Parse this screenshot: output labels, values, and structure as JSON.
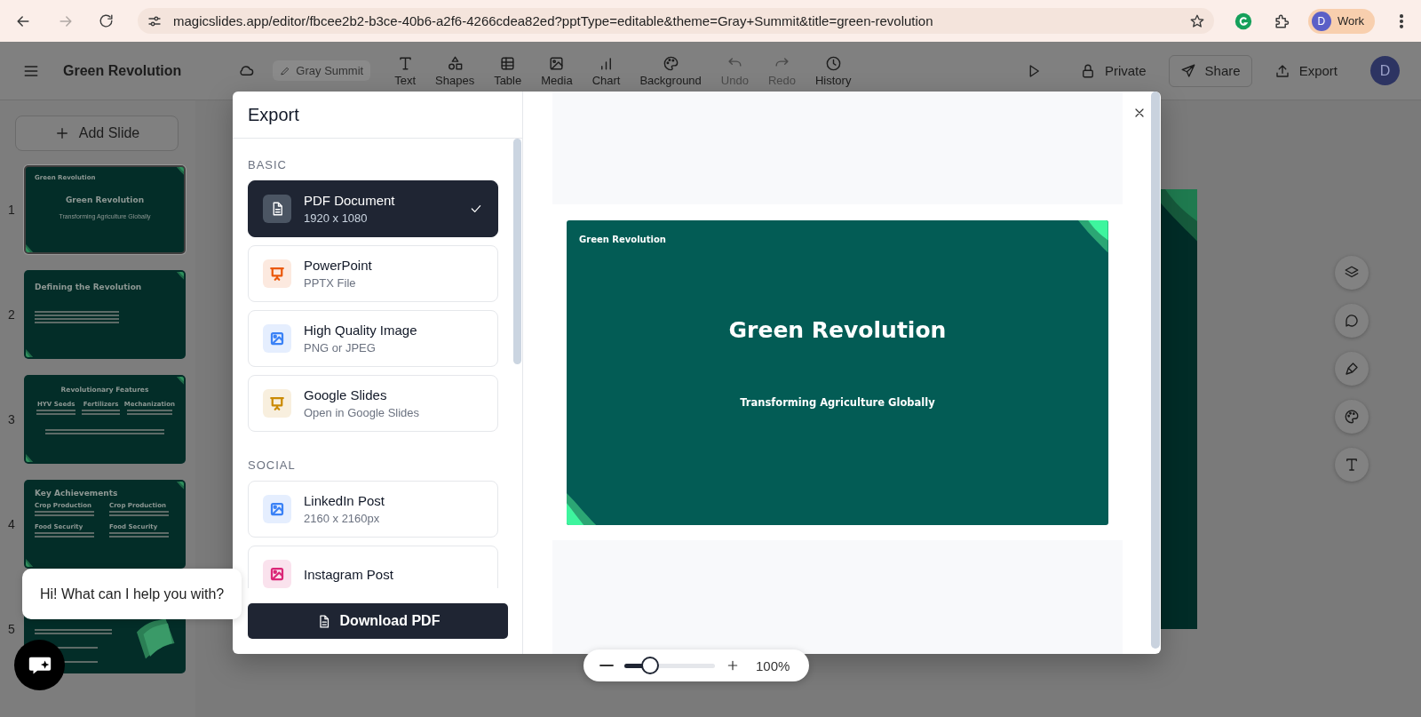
{
  "browser": {
    "url": "magicslides.app/editor/fbcee2b2-b3ce-40b6-a2f6-4266cdea82ed?pptType=editable&theme=Gray+Summit&title=green-revolution",
    "profile": {
      "initial": "D",
      "label": "Work"
    }
  },
  "toolbar": {
    "title": "Green Revolution",
    "theme": "Gray Summit",
    "tools": [
      {
        "label": "Text",
        "disabled": false
      },
      {
        "label": "Shapes",
        "disabled": false
      },
      {
        "label": "Table",
        "disabled": false
      },
      {
        "label": "Media",
        "disabled": false
      },
      {
        "label": "Chart",
        "disabled": false
      },
      {
        "label": "Background",
        "disabled": false
      },
      {
        "label": "Undo",
        "disabled": true
      },
      {
        "label": "Redo",
        "disabled": true
      },
      {
        "label": "History",
        "disabled": false
      }
    ],
    "actions": [
      {
        "label": "Private",
        "kind": "plain"
      },
      {
        "label": "Share",
        "kind": "outlined"
      },
      {
        "label": "Export",
        "kind": "plain"
      }
    ],
    "avatar": "D"
  },
  "sidebar": {
    "add_button": "Add Slide",
    "slides": [
      {
        "number": "1",
        "kind": "title",
        "selected": true,
        "header": "Green Revolution",
        "title": "Green Revolution",
        "subtitle": "Transforming Agriculture Globally"
      },
      {
        "number": "2",
        "kind": "text",
        "selected": false,
        "title": "Defining the Revolution"
      },
      {
        "number": "3",
        "kind": "columns",
        "selected": false,
        "title": "Revolutionary Features",
        "columns": [
          "HYV Seeds",
          "Fertilizers",
          "Mechanization"
        ]
      },
      {
        "number": "4",
        "kind": "grid",
        "selected": false,
        "title": "Key Achievements",
        "items": [
          "Crop Production",
          "Crop Production",
          "Food Security",
          "Food Security"
        ]
      },
      {
        "number": "5",
        "kind": "list",
        "selected": false
      }
    ]
  },
  "modal": {
    "title": "Export",
    "sections": [
      {
        "heading": "BASIC",
        "options": [
          {
            "title": "PDF Document",
            "subtitle": "1920 x 1080",
            "kind": "document",
            "color": "#4b5563",
            "selected": true
          },
          {
            "title": "PowerPoint",
            "subtitle": "PPTX File",
            "kind": "presentation",
            "color": "#ea580c",
            "selected": false
          },
          {
            "title": "High Quality Image",
            "subtitle": "PNG or JPEG",
            "kind": "image",
            "color": "#3b82f6",
            "selected": false
          },
          {
            "title": "Google Slides",
            "subtitle": "Open in Google Slides",
            "kind": "presentation",
            "color": "#ca8a04",
            "selected": false
          }
        ]
      },
      {
        "heading": "SOCIAL",
        "options": [
          {
            "title": "LinkedIn Post",
            "subtitle": "2160 x 2160px",
            "kind": "image",
            "color": "#3b82f6",
            "selected": false
          },
          {
            "title": "Instagram Post",
            "kind": "image",
            "color": "#db2777",
            "selected": false
          }
        ]
      }
    ],
    "download_button": "Download PDF",
    "preview": {
      "header": "Green Revolution",
      "title": "Green Revolution",
      "subtitle": "Transforming Agriculture Globally"
    }
  },
  "zoom": {
    "level": 0.28,
    "reading": "100%"
  },
  "chat": {
    "message": "Hi! What can I help you with?"
  }
}
